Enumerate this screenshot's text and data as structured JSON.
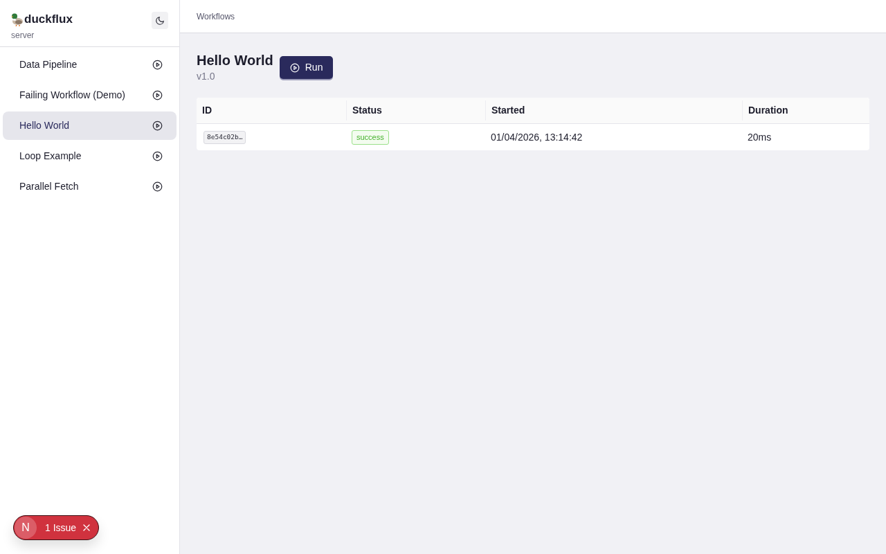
{
  "sidebar": {
    "brand": "duckflux",
    "subtitle": "server",
    "items": [
      {
        "label": "Data Pipeline",
        "selected": false
      },
      {
        "label": "Failing Workflow (Demo)",
        "selected": false
      },
      {
        "label": "Hello World",
        "selected": true
      },
      {
        "label": "Loop Example",
        "selected": false
      },
      {
        "label": "Parallel Fetch",
        "selected": false
      }
    ]
  },
  "breadcrumb": "Workflows",
  "workflow": {
    "title": "Hello World",
    "version": "v1.0",
    "run_label": "Run"
  },
  "table": {
    "columns": [
      "ID",
      "Status",
      "Started",
      "Duration"
    ],
    "rows": [
      {
        "id": "8e54c02b…",
        "status": {
          "label": "success",
          "kind": "success"
        },
        "started": "01/04/2026, 13:14:42",
        "duration": "20ms"
      }
    ]
  },
  "issues_badge": {
    "letter": "N",
    "label": "1 Issue"
  }
}
